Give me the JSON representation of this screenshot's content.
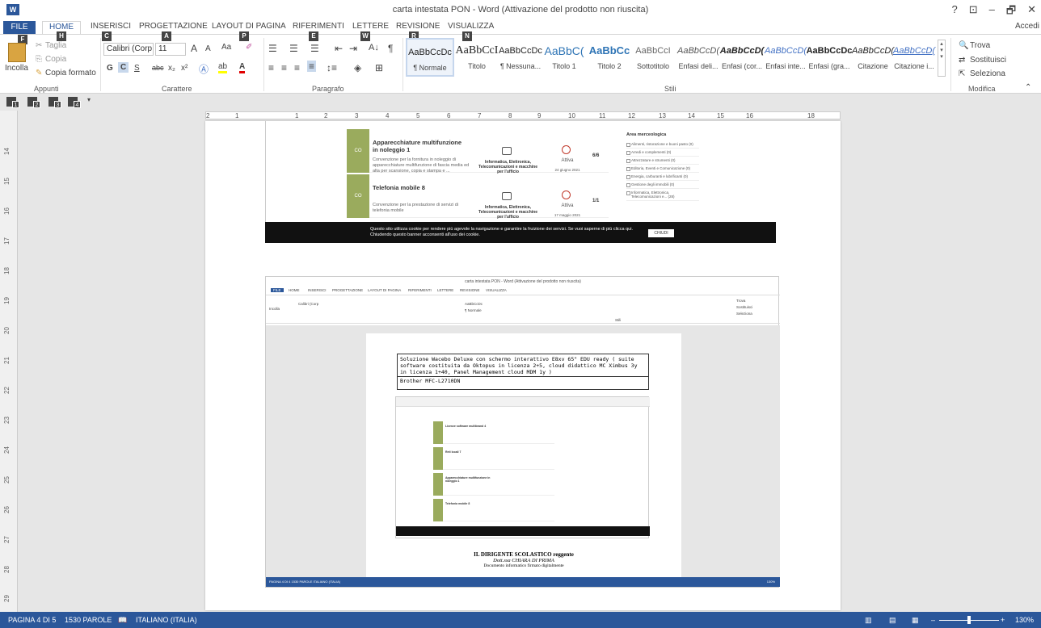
{
  "window": {
    "title": "carta intestata PON - Word (Attivazione del prodotto non riuscita)",
    "controls": [
      "?",
      "⊡",
      "–",
      "🗗",
      "✕"
    ],
    "account": "Accedi",
    "app_icon": "W"
  },
  "tabs": [
    "FILE",
    "HOME",
    "INSERISCI",
    "PROGETTAZIONE",
    "LAYOUT DI PAGINA",
    "RIFERIMENTI",
    "LETTERE",
    "REVISIONE",
    "VISUALIZZA"
  ],
  "keytips": [
    "F",
    "H",
    "C",
    "A",
    "P",
    "E",
    "W",
    "R",
    "N"
  ],
  "ribbon": {
    "clipboard": {
      "paste": "Incolla",
      "cut": "Taglia",
      "copy": "Copia",
      "format_painter": "Copia formato",
      "label": "Appunti"
    },
    "font": {
      "name": "Calibri (Corp",
      "size": "11",
      "grow": "A",
      "shrink": "A",
      "case": "Aa",
      "bold": "G",
      "italic": "C",
      "underline": "S",
      "strike": "abc",
      "sub": "x₂",
      "sup": "x²",
      "label": "Carattere"
    },
    "paragraph": {
      "label": "Paragrafo",
      "pilcrow": "¶"
    },
    "styles": {
      "items": [
        {
          "preview": "AaBbCcDc",
          "name": "¶ Normale"
        },
        {
          "preview": "AaBbCcI",
          "name": "Titolo"
        },
        {
          "preview": "AaBbCcDc",
          "name": "¶ Nessuna..."
        },
        {
          "preview": "AaBbC(",
          "name": "Titolo 1"
        },
        {
          "preview": "AaBbCc",
          "name": "Titolo 2"
        },
        {
          "preview": "AaBbCcI",
          "name": "Sottotitolo"
        },
        {
          "preview": "AaBbCcD(",
          "name": "Enfasi deli..."
        },
        {
          "preview": "AaBbCcD(",
          "name": "Enfasi (cor..."
        },
        {
          "preview": "AaBbCcD(",
          "name": "Enfasi inte..."
        },
        {
          "preview": "AaBbCcDc",
          "name": "Enfasi (gra..."
        },
        {
          "preview": "AaBbCcD(",
          "name": "Citazione"
        },
        {
          "preview": "AaBbCcD(",
          "name": "Citazione i..."
        }
      ],
      "label": "Stili"
    },
    "editing": {
      "find": "Trova",
      "replace": "Sostituisci",
      "select": "Seleziona",
      "label": "Modifica"
    }
  },
  "qat_keytips": [
    "1",
    "2",
    "3",
    "4"
  ],
  "ruler": {
    "h": [
      "2",
      "1",
      "1",
      "2",
      "3",
      "4",
      "5",
      "6",
      "7",
      "8",
      "9",
      "10",
      "11",
      "12",
      "13",
      "14",
      "15",
      "16",
      "18"
    ],
    "v": [
      "14",
      "15",
      "16",
      "17",
      "18",
      "19",
      "20",
      "21",
      "22",
      "23",
      "24",
      "25",
      "26",
      "27",
      "28",
      "29"
    ]
  },
  "shot1": {
    "cards": [
      {
        "code": "CO",
        "title": "Apparecchiature multifunzione in noleggio 1",
        "desc": "Convenzione per la fornitura in noleggio di apparecchiature multifunzione di fascia media ed alta per scansione, copia e stampa e ...",
        "category": "Informatica, Elettronica, Telecomunicazioni e macchine per l'ufficio",
        "status": "Attiva",
        "date": "24 giugno 2021",
        "count": "6/6"
      },
      {
        "code": "CO",
        "title": "Telefonia mobile 8",
        "desc": "Convenzione per la prestazione di servizi di telefonia mobile",
        "category": "Informatica, Elettronica, Telecomunicazioni e macchine per l'ufficio",
        "status": "Attiva",
        "date": "17 maggio 2021",
        "count": "1/1"
      }
    ],
    "sidebar": {
      "title": "Area merceologica",
      "items": [
        "Alimenti, ristorazione e buoni pasto (0)",
        "Arredi e complementi (0)",
        "Attrezzature e strumenti (0)",
        "Editoria, Eventi e Comunicazione (0)",
        "Energia, carburanti e lubrificanti (0)",
        "Gestione degli immobili (0)",
        "Informatica, Elettronica, Telecomunicazioni e... (28)"
      ]
    },
    "cookie": {
      "text": "Questo sito utilizza cookie per rendere più agevole la navigazione e garantire la fruizione dei servizi. Se vuoi saperne di più clicca qui. Chiudendo questo banner acconsenti all'uso dei cookie.",
      "button": "CHIUDI"
    }
  },
  "shot2": {
    "title": "carta intestata PON - Word (Attivazione del prodotto non riuscita)",
    "tabs": [
      "FILE",
      "HOME",
      "INSERISCI",
      "PROGETTAZIONE",
      "LAYOUT DI PAGINA",
      "RIFERIMENTI",
      "LETTERE",
      "REVISIONE",
      "VISUALIZZA"
    ],
    "box_line1": "Soluzione Wacebo Deluxe con schermo interattivo E8xv 65\" EDU ready ( suite software costituita da Oktopus in licenza 2+5, cloud didattico MC Ximbus 3y in licenza 1+40, Panel Management cloud MDM 1y )",
    "box_line2": "Brother MFC-L2710DN",
    "inner_cards": [
      "Licenze software multibrand 4",
      "Reti locali 7",
      "Apparecchiature multifunzione in noleggio 1",
      "Telefonia mobile 8"
    ],
    "sign1": "IL DIRIGENTE SCOLASTICO reggente",
    "sign2": "Dott.ssa CHIARA DI PRIMA",
    "sign3": "Documento informatico firmato digitalmente",
    "status": "PAGINA 4 DI 4    1530 PAROLE    ITALIANO (ITALIA)",
    "zoom": "130%"
  },
  "statusbar": {
    "page": "PAGINA 4 DI 5",
    "words": "1530 PAROLE",
    "lang": "ITALIANO (ITALIA)",
    "zoom": "130%"
  },
  "colors": {
    "accent": "#2b579a",
    "green": "#9aab5d"
  }
}
